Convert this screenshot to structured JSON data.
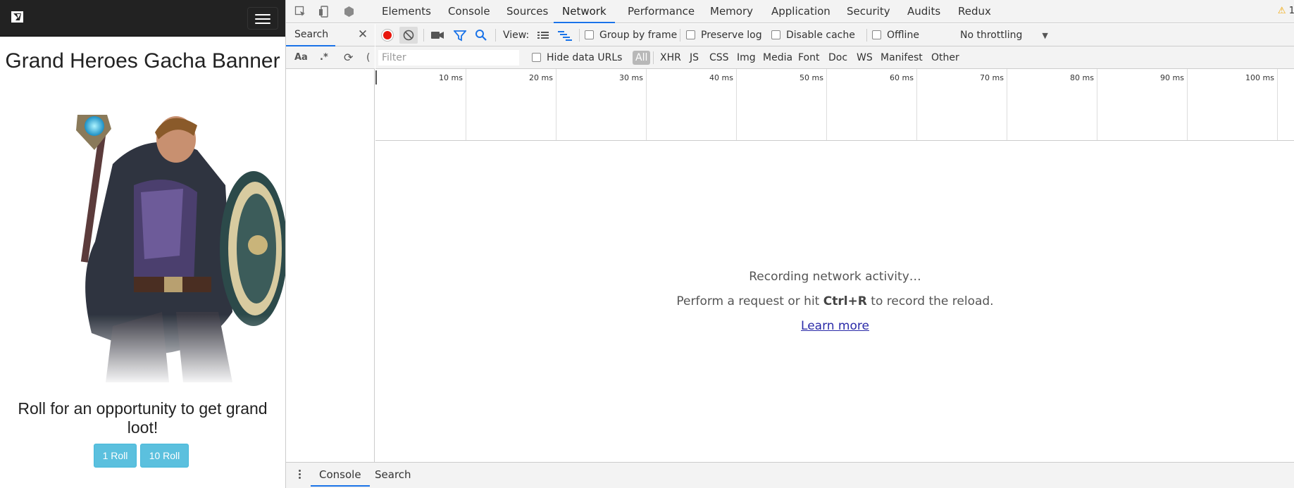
{
  "page": {
    "title": "Grand Heroes Gacha Banner",
    "tagline": "Roll for an opportunity to get grand loot!",
    "roll_buttons": [
      "1 Roll",
      "10 Roll"
    ]
  },
  "devtools": {
    "panel_tabs": [
      "Elements",
      "Console",
      "Sources",
      "Network",
      "Performance",
      "Memory",
      "Application",
      "Security",
      "Audits",
      "Redux"
    ],
    "active_tab": "Network",
    "warning_count": "1",
    "search": {
      "title": "Search",
      "match_case": "Aa",
      "regex": ".*"
    },
    "network_toolbar": {
      "view_label": "View:",
      "group_by_frame": "Group by frame",
      "preserve_log": "Preserve log",
      "disable_cache": "Disable cache",
      "offline": "Offline",
      "throttling": "No throttling"
    },
    "filter": {
      "placeholder": "Filter",
      "hide_data_urls": "Hide data URLs",
      "types": [
        "All",
        "XHR",
        "JS",
        "CSS",
        "Img",
        "Media",
        "Font",
        "Doc",
        "WS",
        "Manifest",
        "Other"
      ],
      "active_type": "All"
    },
    "timeline_ticks": [
      "10 ms",
      "20 ms",
      "30 ms",
      "40 ms",
      "50 ms",
      "60 ms",
      "70 ms",
      "80 ms",
      "90 ms",
      "100 ms"
    ],
    "empty_state": {
      "recording": "Recording network activity…",
      "hint_prefix": "Perform a request or hit ",
      "hint_shortcut": "Ctrl+R",
      "hint_suffix": " to record the reload.",
      "learn_more": "Learn more"
    },
    "drawer_tabs": [
      "Console",
      "Search"
    ],
    "active_drawer_tab": "Console"
  },
  "colors": {
    "accent": "#1a73e8",
    "record": "#e8160c",
    "button": "#5bc0de",
    "navbar": "#222222"
  }
}
